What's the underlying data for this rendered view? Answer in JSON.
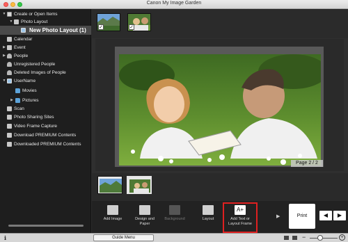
{
  "window": {
    "title": "Canon My Image Garden"
  },
  "sidebar": {
    "items": [
      {
        "label": "Create or Open Items"
      },
      {
        "label": "Photo Layout"
      },
      {
        "label": "New Photo Layout (1)"
      },
      {
        "label": "Calendar"
      },
      {
        "label": "Event"
      },
      {
        "label": "People"
      },
      {
        "label": "Unregistered People"
      },
      {
        "label": "Deleted Images of People"
      },
      {
        "label": "UserName"
      },
      {
        "label": "Movies"
      },
      {
        "label": "Pictures"
      },
      {
        "label": "Scan"
      },
      {
        "label": "Photo Sharing Sites"
      },
      {
        "label": "Video Frame Capture"
      },
      {
        "label": "Download PREMIUM Contents"
      },
      {
        "label": "Downloaded PREMIUM Contents"
      }
    ]
  },
  "viewer": {
    "page_indicator": "Page 2 / 2"
  },
  "toolbar": {
    "add_image": "Add Image",
    "design_paper": "Design and Paper",
    "background": "Background",
    "layout": "Layout",
    "add_text": "Add Text or Layout Frame",
    "print": "Print"
  },
  "status": {
    "guide_menu": "Guide Menu"
  },
  "colors": {
    "highlight": "#e02020"
  }
}
